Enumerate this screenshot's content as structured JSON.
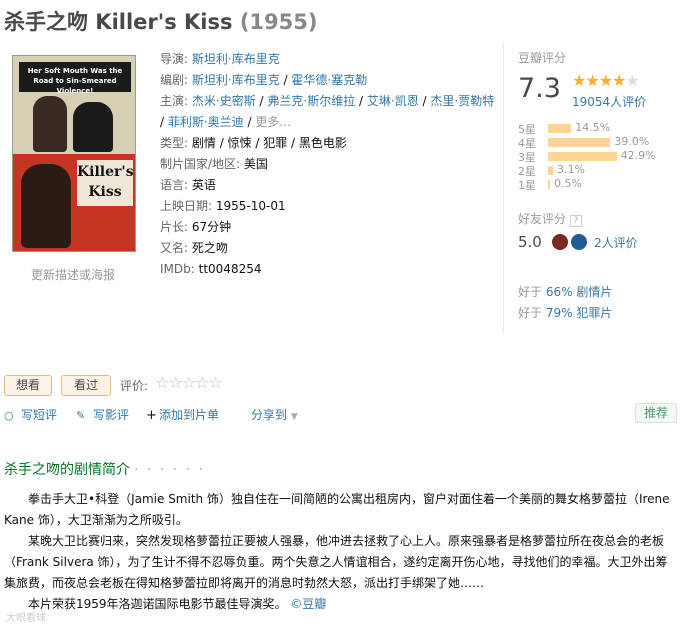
{
  "title": {
    "name": "杀手之吻 Killer's Kiss",
    "year": "(1955)"
  },
  "poster": {
    "tagline": "Her Soft Mouth Was the Road to Sin-Smeared Violence!",
    "name_line1": "Killer's",
    "name_line2": "Kiss",
    "update_link": "更新描述或海报"
  },
  "info": {
    "director": {
      "label": "导演",
      "value": "斯坦利·库布里克"
    },
    "writers": {
      "label": "编剧",
      "items": [
        "斯坦利·库布里克",
        "霍华德·塞克勒"
      ]
    },
    "cast": {
      "label": "主演",
      "items": [
        "杰米·史密斯",
        "弗兰克·斯尔维拉",
        "艾琳·凯恩",
        "杰里·贾勒特",
        "菲利斯·奥兰迪"
      ],
      "more": "更多..."
    },
    "genre": {
      "label": "类型:",
      "value": "剧情 / 惊悚 / 犯罪 / 黑色电影"
    },
    "country": {
      "label": "制片国家/地区:",
      "value": "美国"
    },
    "language": {
      "label": "语言:",
      "value": "英语"
    },
    "release": {
      "label": "上映日期:",
      "value": "1955-10-01"
    },
    "runtime": {
      "label": "片长:",
      "value": "67分钟"
    },
    "aka": {
      "label": "又名:",
      "value": "死之吻"
    },
    "imdb": {
      "label": "IMDb:",
      "value": "tt0048254"
    }
  },
  "rating": {
    "label": "豆瓣评分",
    "score": "7.3",
    "stars_filled": 3.5,
    "votes": "19054人评价",
    "distribution": [
      {
        "label": "5星",
        "pct": "14.5%",
        "value": 14.5
      },
      {
        "label": "4星",
        "pct": "39.0%",
        "value": 39.0
      },
      {
        "label": "3星",
        "pct": "42.9%",
        "value": 42.9
      },
      {
        "label": "2星",
        "pct": "3.1%",
        "value": 3.1
      },
      {
        "label": "1星",
        "pct": "0.5%",
        "value": 0.5
      }
    ],
    "friend_label": "好友评分",
    "friend_help": "?",
    "friend_score": "5.0",
    "friend_count": "2人评价",
    "better_than": [
      {
        "prefix": "好于",
        "pct": "66%",
        "genre": "剧情片"
      },
      {
        "prefix": "好于",
        "pct": "79%",
        "genre": "犯罪片"
      }
    ]
  },
  "actions": {
    "want": "想看",
    "seen": "看过",
    "rate_label": "评价:",
    "rate_stars": "☆☆☆☆☆",
    "short_review": "写短评",
    "review": "写影评",
    "add_list": "添加到片单",
    "share": "分享到",
    "recommend": "推荐"
  },
  "summary": {
    "title": "杀手之吻的剧情简介",
    "dots": "· · · · · ·",
    "p1": "拳击手大卫•科登（Jamie Smith 饰）独自住在一间简陋的公寓出租房内，窗户对面住着一个美丽的舞女格萝蕾拉（Irene Kane 饰），大卫渐渐为之所吸引。",
    "p2": "某晚大卫比赛归来，突然发现格萝蕾拉正要被人强暴，他冲进去拯救了心上人。原来强暴者是格萝蕾拉所在夜总会的老板（Frank Silvera 饰），为了生计不得不忍辱负重。两个失意之人情谊相合，遂约定离开伤心地，寻找他们的幸福。大卫外出筹集旅费，而夜总会老板在得知格萝蕾拉即将离开的消息时勃然大怒，派出打手绑架了她……",
    "p3": "本片荣获1959年洛迦诺国际电影节最佳导演奖。",
    "source": "©豆瓣",
    "watermark": "大眼看球"
  },
  "colors": {
    "link": "#3377aa",
    "green": "#007722",
    "star": "#ffac2d",
    "bar": "#ffd596"
  }
}
